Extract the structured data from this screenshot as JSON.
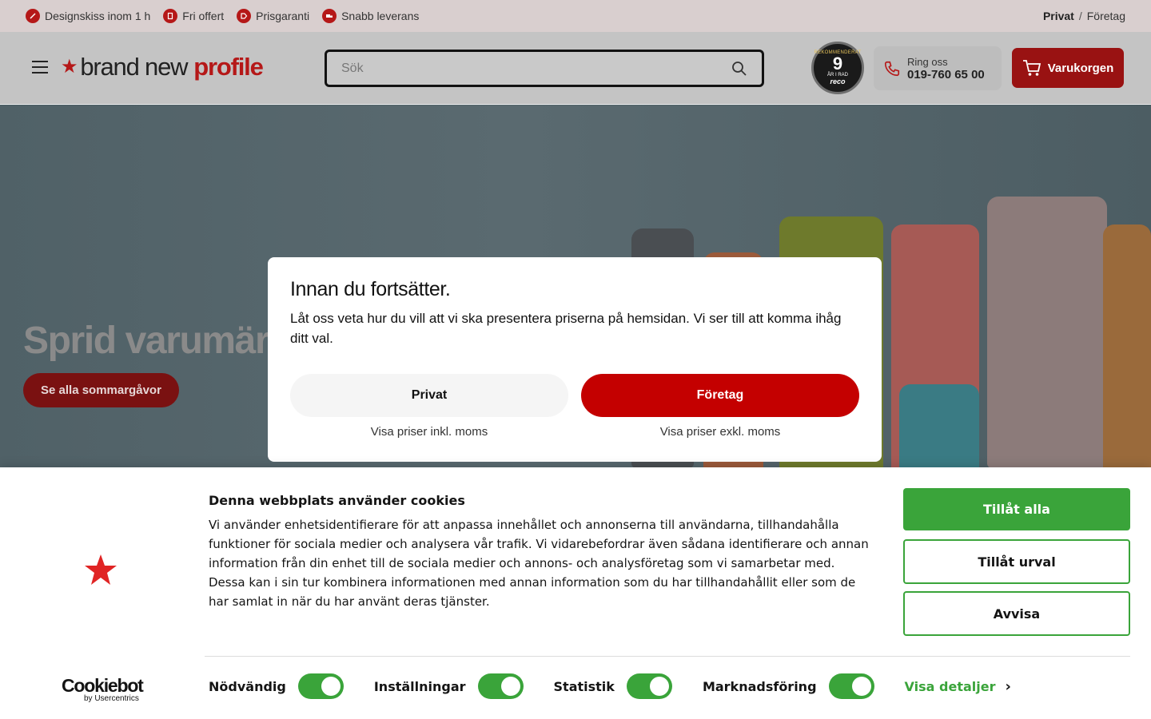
{
  "topbar": {
    "usps": [
      {
        "label": "Designskiss inom 1 h",
        "icon": "pencil-icon"
      },
      {
        "label": "Fri offert",
        "icon": "document-icon"
      },
      {
        "label": "Prisgaranti",
        "icon": "tag-icon"
      },
      {
        "label": "Snabb leverans",
        "icon": "truck-icon"
      }
    ],
    "segment": {
      "active": "Privat",
      "separator": "/",
      "other": "Företag"
    }
  },
  "header": {
    "logo": {
      "part1": "brand new",
      "part2": "profile"
    },
    "search": {
      "placeholder": "Sök"
    },
    "badge": {
      "top": "REKOMMENDERAT",
      "number": "9",
      "sub": "ÅR I RAD",
      "brand": "reco"
    },
    "phone": {
      "label": "Ring oss",
      "number": "019-760 65 00"
    },
    "cart": {
      "label": "Varukorgen"
    }
  },
  "hero": {
    "title": "Sprid varumärk",
    "button": "Se alla sommargåvor"
  },
  "modal": {
    "title": "Innan du fortsätter.",
    "text": "Låt oss veta hur du vill att vi ska presentera priserna på hemsidan. Vi ser till att komma ihåg ditt val.",
    "private_button": "Privat",
    "private_note": "Visa priser inkl. moms",
    "company_button": "Företag",
    "company_note": "Visa priser exkl. moms"
  },
  "cookie": {
    "title": "Denna webbplats använder cookies",
    "text": "Vi använder enhetsidentifierare för att anpassa innehållet och annonserna till användarna, tillhandahålla funktioner för sociala medier och analysera vår trafik. Vi vidarebefordrar även sådana identifierare och annan information från din enhet till de sociala medier och annons- och analysföretag som vi samarbetar med. Dessa kan i sin tur kombinera informationen med annan information som du har tillhandahållit eller som de har samlat in när du har använt deras tjänster.",
    "allow_all": "Tillåt alla",
    "allow_selection": "Tillåt urval",
    "deny": "Avvisa",
    "categories": [
      {
        "label": "Nödvändig",
        "checked": true
      },
      {
        "label": "Inställningar",
        "checked": true
      },
      {
        "label": "Statistik",
        "checked": true
      },
      {
        "label": "Marknadsföring",
        "checked": true
      }
    ],
    "details": "Visa detaljer",
    "logo": {
      "main": "Cookiebot",
      "sub": "by Usercentrics"
    }
  },
  "colors": {
    "brand_red": "#b51818",
    "button_red": "#c40000",
    "cookie_green": "#3aa43a"
  }
}
